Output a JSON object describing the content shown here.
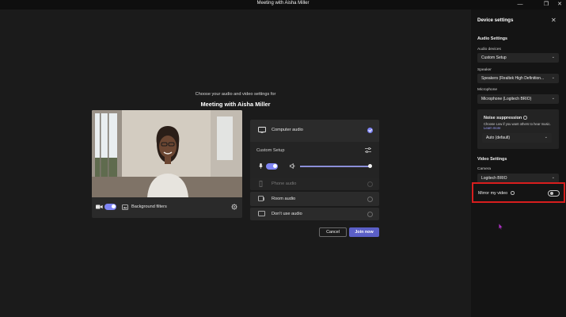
{
  "window": {
    "title": "Meeting with Aisha Miller",
    "controls": [
      "minimize-icon",
      "maximize-icon",
      "close-icon"
    ]
  },
  "main": {
    "subtitle": "Choose your audio and video settings for",
    "title": "Meeting with Aisha Miller",
    "video": {
      "camera_on": true,
      "background_filters_label": "Background filters"
    },
    "audio_options": [
      {
        "label": "Computer audio",
        "selected": true,
        "icon": "computer-audio-icon"
      },
      {
        "label": "Phone audio",
        "selected": false,
        "icon": "phone-icon",
        "disabled": true
      },
      {
        "label": "Room audio",
        "selected": false,
        "icon": "room-icon"
      },
      {
        "label": "Don't use audio",
        "selected": false,
        "icon": "no-audio-icon"
      }
    ],
    "custom_setup_label": "Custom Setup",
    "mic_on": true,
    "speaker_volume": 0.98,
    "cancel_label": "Cancel",
    "join_label": "Join now"
  },
  "device_settings": {
    "title": "Device settings",
    "audio_settings_title": "Audio Settings",
    "audio_devices_label": "Audio devices",
    "audio_devices_value": "Custom Setup",
    "speaker_label": "Speaker",
    "speaker_value": "Speakers (Realtek High Definition...",
    "microphone_label": "Microphone",
    "microphone_value": "Microphone (Logitech BRIO)",
    "noise_title": "Noise suppression",
    "noise_desc": "Choose Low if you want others to hear music.",
    "noise_link": "Learn more",
    "noise_value": "Auto (default)",
    "video_settings_title": "Video Settings",
    "camera_label": "Camera",
    "camera_value": "Logitech BRIO",
    "mirror_label": "Mirror my video",
    "mirror_on": false
  },
  "colors": {
    "accent": "#7f85f5",
    "join_button": "#5b5fc7",
    "highlight_box": "#d81e1e",
    "cursor": "#b030c8"
  }
}
